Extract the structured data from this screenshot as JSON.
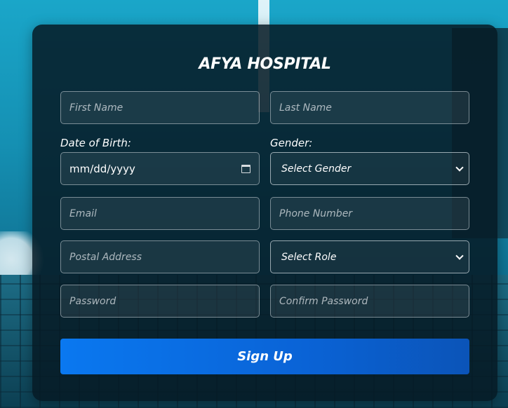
{
  "form": {
    "title": "AFYA HOSPITAL",
    "first_name": {
      "placeholder": "First Name",
      "value": ""
    },
    "last_name": {
      "placeholder": "Last Name",
      "value": ""
    },
    "dob_label": "Date of Birth:",
    "dob_placeholder": "mm/dd/yyyy",
    "gender_label": "Gender:",
    "gender_select": "Select Gender",
    "email": {
      "placeholder": "Email",
      "value": ""
    },
    "phone": {
      "placeholder": "Phone Number",
      "value": ""
    },
    "postal_address": {
      "placeholder": "Postal Address",
      "value": ""
    },
    "role_select": "Select Role",
    "password": {
      "placeholder": "Password",
      "value": ""
    },
    "confirm_password": {
      "placeholder": "Confirm Password",
      "value": ""
    },
    "submit_label": "Sign Up"
  },
  "icons": {
    "calendar": "calendar-icon",
    "chevron": "chevron-down-icon"
  },
  "colors": {
    "card_bg": "#061a24",
    "button_primary": "#0a78f0",
    "text": "#ffffff"
  }
}
